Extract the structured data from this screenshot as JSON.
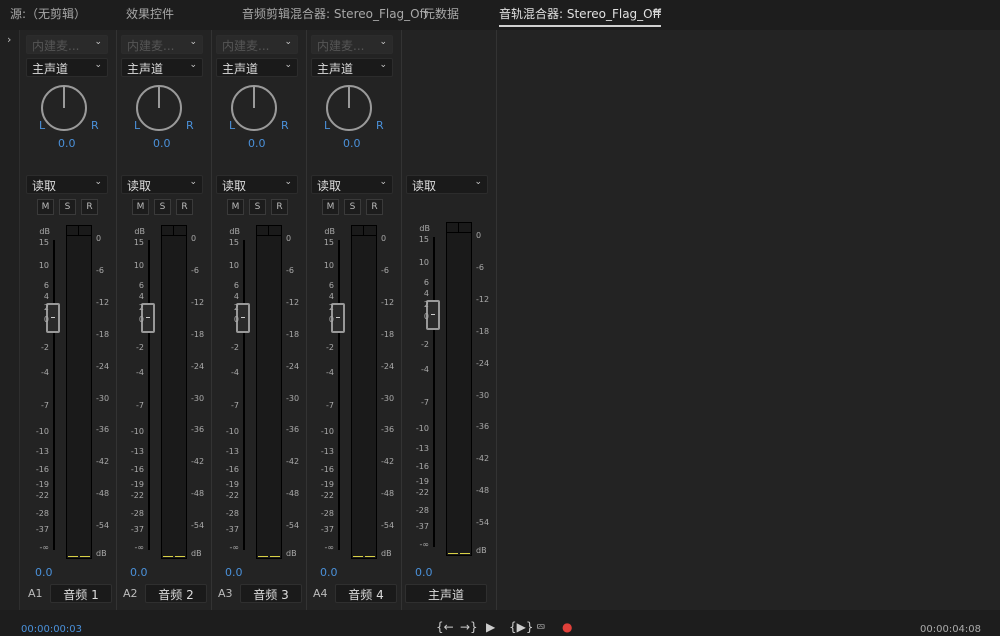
{
  "tabs": [
    {
      "label": "源:（无剪辑）"
    },
    {
      "label": "效果控件"
    },
    {
      "label": "音频剪辑混合器: Stereo_Flag_Off"
    },
    {
      "label": "元数据"
    },
    {
      "label": "音轨混合器: Stereo_Flag_Off",
      "active": true
    }
  ],
  "menu_icon": "≡",
  "expand_icon": "›",
  "tracks": [
    {
      "input": "内建麦...",
      "output": "主声道",
      "pan": "0.0",
      "L": "L",
      "R": "R",
      "automation": "读取",
      "m": "M",
      "s": "S",
      "r": "R",
      "volume": "0.0",
      "id": "A1",
      "name": "音频 1"
    },
    {
      "input": "内建麦...",
      "output": "主声道",
      "pan": "0.0",
      "L": "L",
      "R": "R",
      "automation": "读取",
      "m": "M",
      "s": "S",
      "r": "R",
      "volume": "0.0",
      "id": "A2",
      "name": "音频 2"
    },
    {
      "input": "内建麦...",
      "output": "主声道",
      "pan": "0.0",
      "L": "L",
      "R": "R",
      "automation": "读取",
      "m": "M",
      "s": "S",
      "r": "R",
      "volume": "0.0",
      "id": "A3",
      "name": "音频 3"
    },
    {
      "input": "内建麦...",
      "output": "主声道",
      "pan": "0.0",
      "L": "L",
      "R": "R",
      "automation": "读取",
      "m": "M",
      "s": "S",
      "r": "R",
      "volume": "0.0",
      "id": "A4",
      "name": "音频 4"
    },
    {
      "automation": "读取",
      "volume": "0.0",
      "name": "主声道",
      "master": true
    }
  ],
  "fader_scale": [
    "dB",
    "15",
    "10",
    "6",
    "4",
    "2",
    "0",
    "-2",
    "-4",
    "-7",
    "-10",
    "-13",
    "-16",
    "-19",
    "-22",
    "-28",
    "-37",
    "-∞"
  ],
  "meter_scale": [
    "0",
    "-6",
    "-12",
    "-18",
    "-24",
    "-30",
    "-36",
    "-42",
    "-48",
    "-54",
    "dB"
  ],
  "transport": {
    "current_time": "00:00:00:03",
    "duration": "00:00:04:08",
    "buttons": [
      {
        "icon": "go-to-in-icon",
        "glyph": "{←"
      },
      {
        "icon": "go-to-out-icon",
        "glyph": "→}"
      },
      {
        "icon": "play-icon",
        "glyph": "▶"
      },
      {
        "icon": "play-in-to-out-icon",
        "glyph": "{▶}"
      },
      {
        "icon": "loop-icon",
        "glyph": "⮹"
      },
      {
        "icon": "record-icon",
        "glyph": "●"
      }
    ]
  },
  "colors": {
    "accent": "#4a90d9",
    "record": "#e0403a",
    "meter_level": "#d8d045"
  }
}
